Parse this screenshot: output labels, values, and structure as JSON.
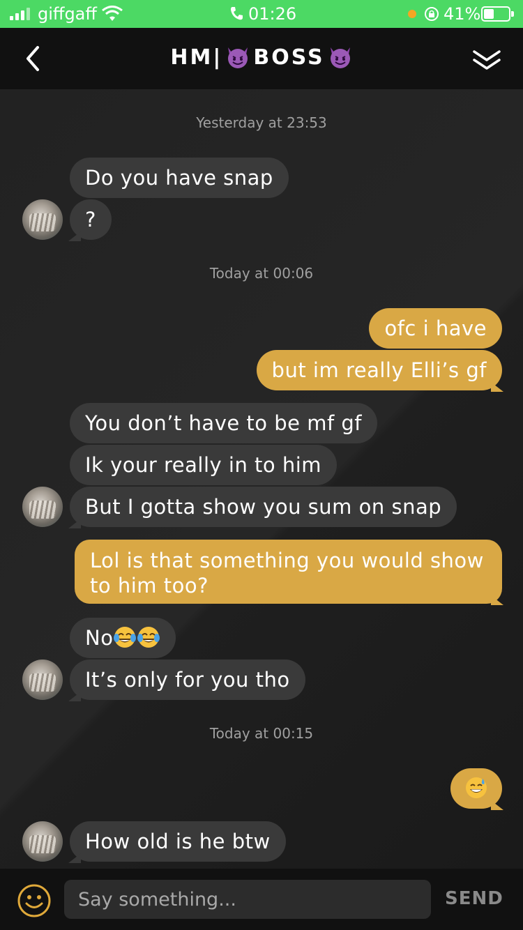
{
  "status_bar": {
    "carrier": "giffgaff",
    "time": "01:26",
    "battery": "41%",
    "background": "#4cd964"
  },
  "header": {
    "title_left": "HM|",
    "title_right": "BOSS",
    "emoji": "smiling-devil"
  },
  "colors": {
    "incoming_bubble": "#3a3a3a",
    "outgoing_bubble": "#d9a845",
    "background": "#1c1c1c"
  },
  "messages": {
    "ts1": "Yesterday at 23:53",
    "m1": "Do you have snap",
    "m2": "?",
    "ts2": "Today at 00:06",
    "m3": "ofc i have",
    "m4": "but im really Elli’s gf",
    "m5": "You don’t have to be mf gf",
    "m6": "Ik your really in to him",
    "m7": "But I gotta show you sum on snap",
    "m8": "Lol is that something you would show to him too?",
    "m9": "No",
    "m9_emoji": "face-with-tears-of-joy x2",
    "m10": "It’s only for you tho",
    "ts3": "Today at 00:15",
    "m11_emoji": "grinning-face-with-sweat",
    "m12": "How old is he btw"
  },
  "input": {
    "placeholder": "Say something...",
    "send_label": "SEND"
  }
}
